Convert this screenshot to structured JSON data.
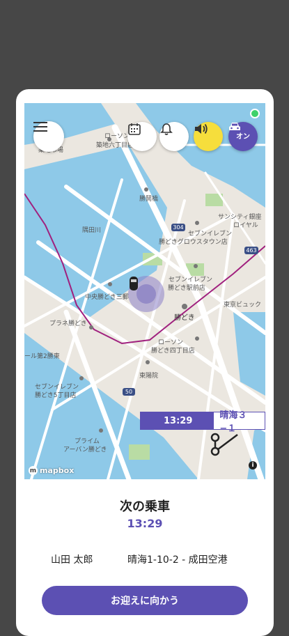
{
  "map": {
    "labels": [
      {
        "text": "ローソン"
      },
      {
        "text": "築地六丁目店"
      },
      {
        "text": "築地市場"
      },
      {
        "text": "勝鬨橋"
      },
      {
        "text": "隅田川"
      },
      {
        "text": "サンシティ銀座"
      },
      {
        "text": "ロイヤル"
      },
      {
        "text": "セブンイレブン"
      },
      {
        "text": "勝どきグロウスタウン店"
      },
      {
        "text": "セブンイレブン"
      },
      {
        "text": "勝どき駅前店"
      },
      {
        "text": "中央勝どき三郵"
      },
      {
        "text": "勝どき"
      },
      {
        "text": "東京ビュック"
      },
      {
        "text": "プラネ勝どき"
      },
      {
        "text": "ローソン"
      },
      {
        "text": "勝どき四丁目店"
      },
      {
        "text": "東陽院"
      },
      {
        "text": "セブンイレブン"
      },
      {
        "text": "勝どき5丁目店"
      },
      {
        "text": "プライム"
      },
      {
        "text": "アーバン勝どき"
      },
      {
        "text": "ール第2勝東"
      }
    ],
    "road_shields": [
      "304",
      "463",
      "50"
    ],
    "eta_time": "13:29",
    "eta_destination": "晴海３−１",
    "attribution": "mapbox",
    "info_icon": "i"
  },
  "toolbar": {
    "menu_icon": "hamburger-icon",
    "calendar_icon": "calendar-icon",
    "bell_icon": "bell-icon",
    "volume_icon": "speaker-icon",
    "car_label": "オン"
  },
  "panel": {
    "title": "次の乗車",
    "time": "13:29",
    "rider_name": "山田 太郎",
    "route": "晴海1-10-2 - 成田空港",
    "pickup_button": "お迎えに向かう"
  },
  "colors": {
    "accent": "#5c50b3",
    "volume_button": "#f6de3c",
    "route_line": "#a0207e",
    "water": "#8ec9e8"
  }
}
